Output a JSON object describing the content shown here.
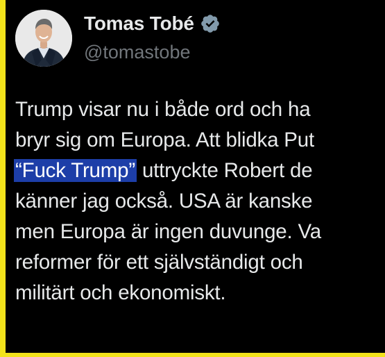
{
  "profile": {
    "display_name": "Tomas Tobé",
    "handle": "@tomastobe",
    "verified": true,
    "avatar_icon": "profile-photo-man-in-suit"
  },
  "tweet": {
    "lines": [
      {
        "before": "Trump visar nu i både ord och ha",
        "highlight": "",
        "after": ""
      },
      {
        "before": "bryr sig om Europa. Att blidka Put",
        "highlight": "",
        "after": ""
      },
      {
        "before": "",
        "highlight": "“Fuck Trump”",
        "after": " uttryckte Robert de"
      },
      {
        "before": "känner jag också. USA är kanske",
        "highlight": "",
        "after": ""
      },
      {
        "before": "men Europa är ingen duvunge. Va",
        "highlight": "",
        "after": ""
      },
      {
        "before": "reformer för ett självständigt och",
        "highlight": "",
        "after": ""
      },
      {
        "before": "militärt och ekonomiskt.",
        "highlight": "",
        "after": ""
      }
    ]
  },
  "colors": {
    "frame": "#f2e21b",
    "background": "#000000",
    "text": "#e7e9ea",
    "muted": "#71767b",
    "selection": "#1d3ea8",
    "verified_badge": "#829aab"
  }
}
